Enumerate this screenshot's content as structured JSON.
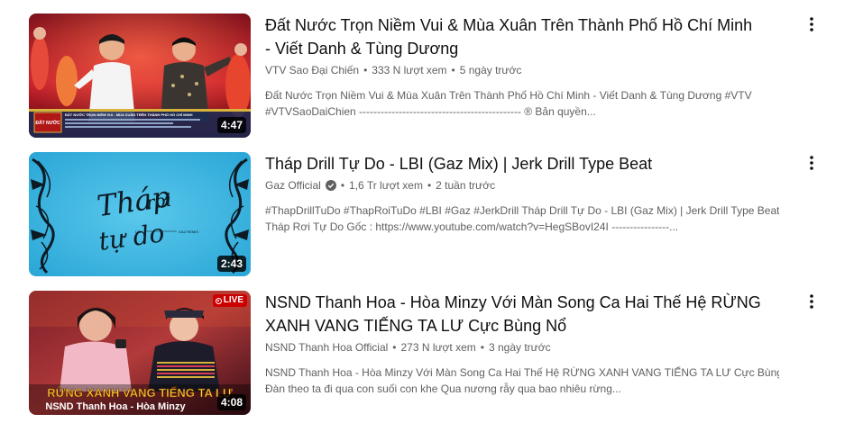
{
  "videos": [
    {
      "title_line1": "Đất Nước Trọn Niềm Vui & Mùa Xuân Trên Thành Phố Hồ Chí Minh",
      "title_line2": "- Viết Danh & Tùng Dương",
      "channel": "VTV Sao Đại Chiến",
      "views": "333 N lượt xem",
      "age": "5 ngày trước",
      "desc_line1": "Đất Nước Trọn Niềm Vui & Mùa Xuân Trên Thành Phố Hồ Chí Minh - Viết Danh & Tùng Dương #VTV",
      "desc_line2": "#VTVSaoDaiChien --------------------------------------------- ® Bản quyền...",
      "duration": "4:47",
      "thumb_overlay_text": "ĐẤT NƯỚC TRỌN NIỀM VUI - MÙA XUÂN TRÊN THÀNH PHỐ HỒ CHÍ MINH",
      "thumb_logo_text": "ĐẤT NƯỚC"
    },
    {
      "title_line1": "Tháp Drill Tự Do - LBI (Gaz Mix) | Jerk Drill Type Beat",
      "channel": "Gaz Official",
      "verified": true,
      "views": "1,6 Tr lượt xem",
      "age": "2 tuần trước",
      "desc_line1": "#ThapDrillTuDo #ThapRoiTuDo #LBI #Gaz #JerkDrill Tháp Drill Tự Do - LBI (Gaz Mix) | Jerk Drill Type Beat",
      "desc_line2": "Tháp Rơi Tự Do Gốc : https://www.youtube.com/watch?v=HegSBovI24I ----------------...",
      "duration": "2:43",
      "thumb_script_top": "Tháp",
      "thumb_script_right": "rơi",
      "thumb_script_bottom": "tự do",
      "thumb_small_left": "LBI",
      "thumb_small_right": "GAZ REMIX"
    },
    {
      "title_line1": "NSND Thanh Hoa - Hòa Minzy Với Màn Song Ca Hai Thế Hệ RỪNG",
      "title_line2": "XANH VANG TIẾNG TA LƯ Cực Bùng Nổ",
      "channel": "NSND Thanh Hoa Official",
      "views": "273 N lượt xem",
      "age": "3 ngày trước",
      "desc_line1": "NSND Thanh Hoa - Hòa Minzy Với Màn Song Ca Hai Thế Hệ RỪNG XANH VANG TIẾNG TA LƯ Cực Bùng Nổ",
      "desc_line2": "Đàn theo ta đi qua con suối con khe Qua nương rẫy qua bao nhiêu rừng...",
      "duration": "4:08",
      "live_label": "LIVE",
      "thumb_banner_text": "RỪNG XANH VANG TIẾNG TA LƯ",
      "thumb_names_text": "NSND Thanh Hoa - Hòa Minzy"
    }
  ],
  "separator": "•",
  "colors": {
    "text_primary": "#0f0f0f",
    "text_secondary": "#606060",
    "live_red": "#cc0000",
    "thumb2_blue": "#33b2df"
  },
  "icons": {
    "more": "more-vert-icon",
    "verified": "verified-check-icon",
    "live": "live-broadcast-icon"
  }
}
